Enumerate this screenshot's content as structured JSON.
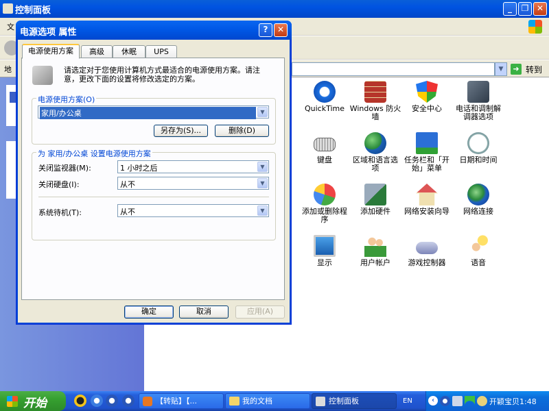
{
  "control_panel": {
    "title": "控制面板",
    "menu_first": "文",
    "address_label": "地",
    "go_label": "转到",
    "icons": [
      {
        "label": "QuickTime",
        "icon": "quicktime-icon"
      },
      {
        "label": "Windows 防火墙",
        "icon": "firewall-icon"
      },
      {
        "label": "安全中心",
        "icon": "security-center-icon"
      },
      {
        "label": "电话和调制解调器选项",
        "icon": "phone-modem-icon"
      },
      {
        "label": "键盘",
        "icon": "keyboard-icon"
      },
      {
        "label": "区域和语言选项",
        "icon": "globe-icon"
      },
      {
        "label": "任务栏和「开始」菜单",
        "icon": "taskbar-icon"
      },
      {
        "label": "日期和时间",
        "icon": "clock-icon"
      },
      {
        "label": "添加或删除程序",
        "icon": "add-remove-icon"
      },
      {
        "label": "添加硬件",
        "icon": "hardware-icon"
      },
      {
        "label": "网络安装向导",
        "icon": "network-wizard-icon"
      },
      {
        "label": "网络连接",
        "icon": "network-icon"
      },
      {
        "label": "显示",
        "icon": "display-icon"
      },
      {
        "label": "用户帐户",
        "icon": "users-icon"
      },
      {
        "label": "游戏控制器",
        "icon": "gamepad-icon"
      },
      {
        "label": "语音",
        "icon": "speech-icon"
      }
    ]
  },
  "dialog": {
    "title": "电源选项 属性",
    "help_button": "?",
    "close_button": "✕",
    "tabs": [
      "电源使用方案",
      "高级",
      "休眠",
      "UPS"
    ],
    "intro_text": "请选定对于您使用计算机方式最适合的电源使用方案。请注意，更改下面的设置将修改选定的方案。",
    "scheme_group_label": "电源使用方案(O)",
    "scheme_value": "家用/办公桌",
    "save_as_button": "另存为(S)...",
    "delete_button": "删除(D)",
    "settings_group_label": "为 家用/办公桌 设置电源使用方案",
    "monitor_label": "关闭监视器(M):",
    "monitor_value": "1 小时之后",
    "harddisk_label": "关闭硬盘(I):",
    "harddisk_value": "从不",
    "standby_label": "系统待机(T):",
    "standby_value": "从不",
    "ok_button": "确定",
    "cancel_button": "取消",
    "apply_button": "应用(A)"
  },
  "taskbar": {
    "start_label": "开始",
    "items": [
      "【转贴】【...",
      "我的文档",
      "控制面板"
    ],
    "lang": "EN",
    "clock": "开颖宝贝1:48"
  }
}
